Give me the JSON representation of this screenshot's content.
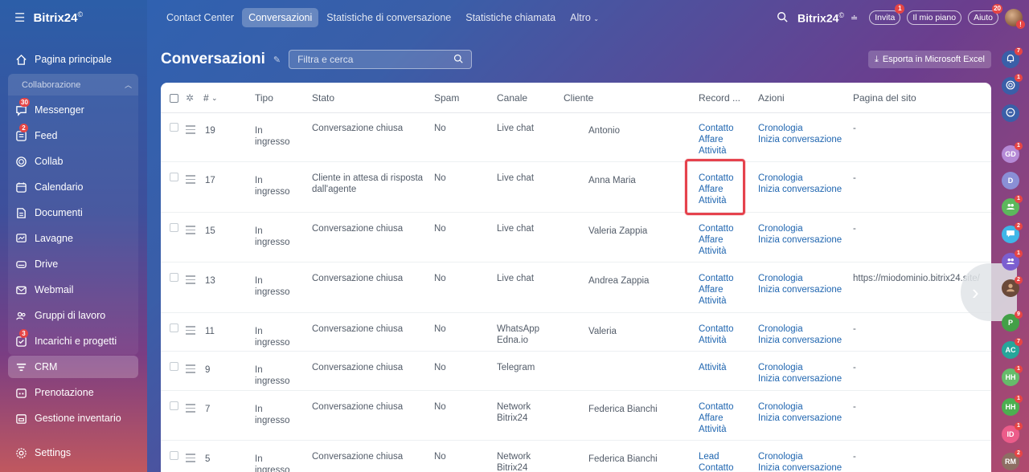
{
  "brand": {
    "name": "Bitrix24",
    "mark": "©"
  },
  "sidebar": {
    "items": [
      {
        "label": "Pagina principale",
        "icon": "home-icon"
      },
      {
        "label": "Collaborazione",
        "icon": "collab-section-icon"
      },
      {
        "label": "Messenger",
        "icon": "messenger-icon",
        "badge": "30"
      },
      {
        "label": "Feed",
        "icon": "feed-icon",
        "badge": "2"
      },
      {
        "label": "Collab",
        "icon": "collab-icon"
      },
      {
        "label": "Calendario",
        "icon": "calendar-icon"
      },
      {
        "label": "Documenti",
        "icon": "document-icon"
      },
      {
        "label": "Lavagne",
        "icon": "whiteboard-icon"
      },
      {
        "label": "Drive",
        "icon": "drive-icon"
      },
      {
        "label": "Webmail",
        "icon": "mail-icon"
      },
      {
        "label": "Gruppi di lavoro",
        "icon": "groups-icon"
      },
      {
        "label": "Incarichi e progetti",
        "icon": "tasks-icon",
        "badge": "3"
      },
      {
        "label": "CRM",
        "icon": "crm-icon"
      },
      {
        "label": "Prenotazione",
        "icon": "booking-icon"
      },
      {
        "label": "Gestione inventario",
        "icon": "inventory-icon"
      },
      {
        "label": "Settings",
        "icon": "settings-icon"
      }
    ]
  },
  "topnav": {
    "tabs": [
      "Contact Center",
      "Conversazioni",
      "Statistiche di conversazione",
      "Statistiche chiamata",
      "Altro"
    ],
    "invite": "Invita",
    "invite_badge": "1",
    "plan": "Il mio piano",
    "help": "Aiuto",
    "help_badge": "20",
    "avatar_badge": "!"
  },
  "page": {
    "title": "Conversazioni",
    "filter_placeholder": "Filtra e cerca",
    "export_label": "Esporta in Microsoft Excel"
  },
  "table": {
    "columns": {
      "num": "#",
      "tipo": "Tipo",
      "stato": "Stato",
      "spam": "Spam",
      "canale": "Canale",
      "cliente": "Cliente",
      "record": "Record ...",
      "azioni": "Azioni",
      "pagina": "Pagina del sito"
    },
    "rows": [
      {
        "num": "19",
        "tipo": [
          "In",
          "ingresso"
        ],
        "stato": [
          "Conversazione chiusa"
        ],
        "spam": "No",
        "canale": [
          "Live chat"
        ],
        "cliente": "Antonio",
        "record": [
          "Contatto",
          "Affare",
          "Attività"
        ],
        "azioni": [
          "Cronologia",
          "Inizia conversazione"
        ],
        "pagina": "-"
      },
      {
        "num": "17",
        "tipo": [
          "In",
          "ingresso"
        ],
        "stato": [
          "Cliente in attesa di risposta",
          "dall'agente"
        ],
        "spam": "No",
        "canale": [
          "Live chat"
        ],
        "cliente": "Anna Maria",
        "record": [
          "Contatto",
          "Affare",
          "Attività"
        ],
        "azioni": [
          "Cronologia",
          "Inizia conversazione"
        ],
        "pagina": "-"
      },
      {
        "num": "15",
        "tipo": [
          "In",
          "ingresso"
        ],
        "stato": [
          "Conversazione chiusa"
        ],
        "spam": "No",
        "canale": [
          "Live chat"
        ],
        "cliente": "Valeria Zappia",
        "record": [
          "Contatto",
          "Affare",
          "Attività"
        ],
        "azioni": [
          "Cronologia",
          "Inizia conversazione"
        ],
        "pagina": "-"
      },
      {
        "num": "13",
        "tipo": [
          "In",
          "ingresso"
        ],
        "stato": [
          "Conversazione chiusa"
        ],
        "spam": "No",
        "canale": [
          "Live chat"
        ],
        "cliente": "Andrea Zappia",
        "record": [
          "Contatto",
          "Affare",
          "Attività"
        ],
        "azioni": [
          "Cronologia",
          "Inizia conversazione"
        ],
        "pagina": "https://miodominio.bitrix24.site/"
      },
      {
        "num": "11",
        "tipo": [
          "In",
          "ingresso"
        ],
        "stato": [
          "Conversazione chiusa"
        ],
        "spam": "No",
        "canale": [
          "WhatsApp",
          "Edna.io"
        ],
        "cliente": "Valeria",
        "record": [
          "Contatto",
          "Attività"
        ],
        "azioni": [
          "Cronologia",
          "Inizia conversazione"
        ],
        "pagina": "-"
      },
      {
        "num": "9",
        "tipo": [
          "In",
          "ingresso"
        ],
        "stato": [
          "Conversazione chiusa"
        ],
        "spam": "No",
        "canale": [
          "Telegram"
        ],
        "cliente": "",
        "record": [
          "Attività"
        ],
        "azioni": [
          "Cronologia",
          "Inizia conversazione"
        ],
        "pagina": "-"
      },
      {
        "num": "7",
        "tipo": [
          "In",
          "ingresso"
        ],
        "stato": [
          "Conversazione chiusa"
        ],
        "spam": "No",
        "canale": [
          "Network",
          "Bitrix24"
        ],
        "cliente": "Federica Bianchi",
        "record": [
          "Contatto",
          "Affare",
          "Attività"
        ],
        "azioni": [
          "Cronologia",
          "Inizia conversazione"
        ],
        "pagina": "-"
      },
      {
        "num": "5",
        "tipo": [
          "In",
          "ingresso"
        ],
        "stato": [
          "Conversazione chiusa"
        ],
        "spam": "No",
        "canale": [
          "Network",
          "Bitrix24"
        ],
        "cliente": "Federica Bianchi",
        "record": [
          "Lead",
          "Contatto"
        ],
        "azioni": [
          "Cronologia",
          "Inizia conversazione"
        ],
        "pagina": "-"
      }
    ]
  },
  "rightbar": {
    "items": [
      {
        "label": "",
        "icon": "bell-icon",
        "badge": "7",
        "color": "#3a5fa8"
      },
      {
        "label": "",
        "icon": "copilot-icon",
        "badge": "1",
        "color": "#3a5fa8"
      },
      {
        "label": "",
        "icon": "search-chat-icon",
        "badge": "",
        "color": "#3a5fa8"
      },
      {
        "label": "GD",
        "icon": "",
        "badge": "1",
        "color": "#b58ad6"
      },
      {
        "label": "D",
        "icon": "",
        "badge": "",
        "color": "#8a8fd6"
      },
      {
        "label": "",
        "icon": "group-chat-icon",
        "badge": "1",
        "color": "#5cb85c"
      },
      {
        "label": "",
        "icon": "chat-icon",
        "badge": "2",
        "color": "#3fb6e8"
      },
      {
        "label": "",
        "icon": "group-chat-icon",
        "badge": "1",
        "color": "#7b5fd0"
      },
      {
        "label": "",
        "icon": "photo-avatar-icon",
        "badge": "2",
        "color": "#6b4a3a"
      },
      {
        "label": "P",
        "icon": "",
        "badge": "9",
        "color": "#43a047"
      },
      {
        "label": "AC",
        "icon": "",
        "badge": "7",
        "color": "#26a69a"
      },
      {
        "label": "HH",
        "icon": "",
        "badge": "1",
        "color": "#66bb6a"
      },
      {
        "label": "HH",
        "icon": "",
        "badge": "1",
        "color": "#4caf50"
      },
      {
        "label": "ID",
        "icon": "",
        "badge": "1",
        "color": "#ec5c8a"
      },
      {
        "label": "RM",
        "icon": "",
        "badge": "2",
        "color": "#8d6e63"
      }
    ]
  }
}
